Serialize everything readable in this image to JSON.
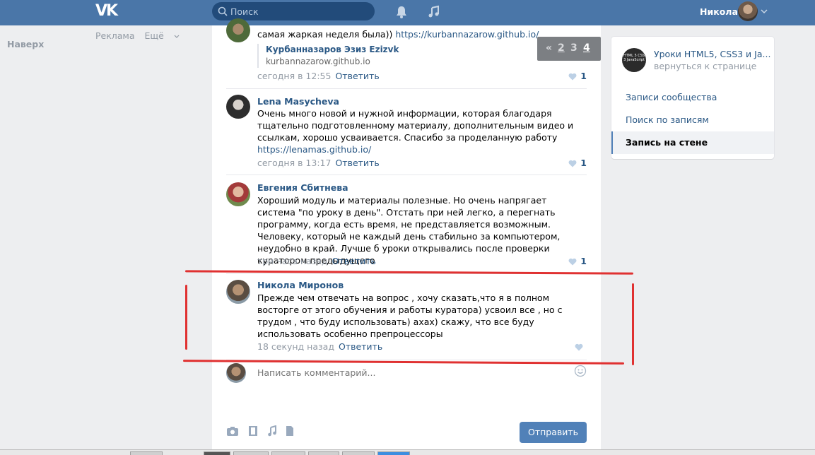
{
  "header": {
    "search_placeholder": "Поиск",
    "user_name": "Никола"
  },
  "left": {
    "up_label": "Наверх",
    "links": [
      "Реклама",
      "Ещё"
    ]
  },
  "pager": {
    "prev": "«",
    "pages": [
      "2",
      "3",
      "4"
    ],
    "current": "4"
  },
  "comments": [
    {
      "text": "самая жаркая неделя была))",
      "link": "https://kurbannazarow.github.io/",
      "quote_title": "Курбанназаров Эзиз Ezizvk",
      "quote_sub": "kurbannazarow.github.io",
      "time": "сегодня в 12:55",
      "reply": "Ответить",
      "likes": "1"
    },
    {
      "name": "Lena Masycheva",
      "text": "Очень много новой и нужной информации, которая благодаря тщательно подготовленному материалу, дополнительным видео и ссылкам, хорошо усваивается. Спасибо за проделанную работу",
      "link": "https://lenamas.github.io/",
      "time": "сегодня в 13:17",
      "reply": "Ответить",
      "likes": "1"
    },
    {
      "name": "Евгения Сбитнева",
      "text": "Хороший модуль и материалы полезные. Но очень напрягает система \"по уроку в день\". Отстать при ней легко, а перегнать программу, когда есть время, не представляется возможным. Человеку, который не каждый день стабильно за компьютером, неудобно в край. Лучше б уроки открывались после проверки куратором предыдущего",
      "time": "три часа назад",
      "reply": "Ответить",
      "likes": "1"
    },
    {
      "name": "Никола Миронов",
      "text": "Прежде чем отвечать на вопрос , хочу сказать,что я в полном восторге от этого обучения и работы куратора) усвоил все , но с трудом , что буду использовать) ахах) скажу, что все буду использовать особенно препроцессоры",
      "time": "18 секунд назад",
      "reply": "Ответить"
    }
  ],
  "composer": {
    "placeholder": "Написать комментарий...",
    "send_label": "Отправить"
  },
  "right": {
    "group_title": "Уроки HTML5, CSS3 и Ja...",
    "back_label": "вернуться к странице",
    "avatar_text": "HTML 5 CSS 3 JavaScript",
    "items": [
      "Записи сообщества",
      "Поиск по записям",
      "Запись на стене"
    ]
  },
  "colors": {
    "header": "#4a76a8",
    "link": "#2a5885",
    "button": "#5181b8",
    "annotation": "#e03131"
  },
  "icons": [
    "vk-logo-icon",
    "search-icon",
    "bell-icon",
    "music-icon",
    "chevron-down-icon",
    "heart-icon",
    "smile-icon",
    "camera-icon",
    "video-icon",
    "audio-icon",
    "document-icon"
  ]
}
